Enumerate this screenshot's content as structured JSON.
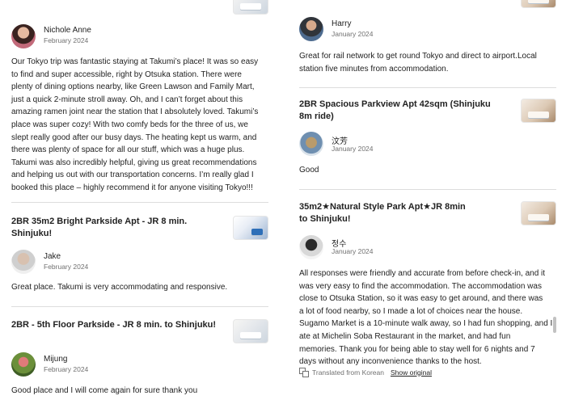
{
  "left": {
    "review1": {
      "name": "Nichole Anne",
      "date": "February 2024",
      "lines": [
        "Our Tokyo trip was fantastic staying at Takumi’s place! It was so easy",
        "to find and super accessible, right by Otsuka station. There were",
        "plenty of dining options nearby, like Green Lawson and Family Mart,",
        "just a quick 2-minute stroll away. Oh, and I can’t forget about this",
        "amazing ramen joint near the station that I absolutely loved. Takumi’s",
        "place was super cozy! With two comfy beds for the three of us, we",
        "slept really good after our busy days. The heating kept us warm, and",
        "there was plenty of space for all our stuff, which was a huge plus.",
        "Takumi was also incredibly helpful, giving us great recommendations",
        "and helping us out with our transportation concerns. I’m really glad I",
        "booked this place – highly recommend it for anyone visiting Tokyo!!!"
      ]
    },
    "listing2": {
      "title": "2BR 35m2 Bright Parkside Apt - JR 8 min. Shinjuku!",
      "name": "Jake",
      "date": "February 2024",
      "text": "Great place. Takumi is very accommodating and responsive."
    },
    "listing3": {
      "title": "2BR - 5th Floor Parkside - JR 8 min. to Shinjuku!",
      "name": "Mijung",
      "date": "February 2024",
      "text": "Good place and I will come again for sure thank you"
    }
  },
  "right": {
    "review1": {
      "name": "Harry",
      "date": "January 2024",
      "lines": [
        "Great for rail network to get round Tokyo and direct to airport.Local",
        "station five minutes from accommodation."
      ]
    },
    "listing2": {
      "title_lines": [
        "2BR Spacious Parkview Apt 42sqm (Shinjuku",
        "8m ride)"
      ],
      "name": "汶芳",
      "date": "January 2024",
      "text": "Good"
    },
    "listing3": {
      "title_lines": [
        "35m2★Natural Style Park Apt★JR 8min",
        "to Shinjuku!"
      ],
      "name": "정수",
      "date": "January 2024",
      "lines": [
        "All responses were friendly and accurate from before check-in, and it",
        "was very easy to find the accommodation. The accommodation was",
        "close to Otsuka Station, so it was easy to get around, and there was",
        "a lot of food nearby, so I made a lot of choices near the house.",
        "Sugamo Market is a 10-minute walk away, so I had fun shopping, and I",
        "ate at Michelin Soba Restaurant in the market, and had fun",
        "memories. Thank you for being able to stay well for 6 nights and 7",
        "days without any inconvenience thanks to the host."
      ],
      "translated_note": "Translated from Korean",
      "show_original": "Show original"
    }
  }
}
